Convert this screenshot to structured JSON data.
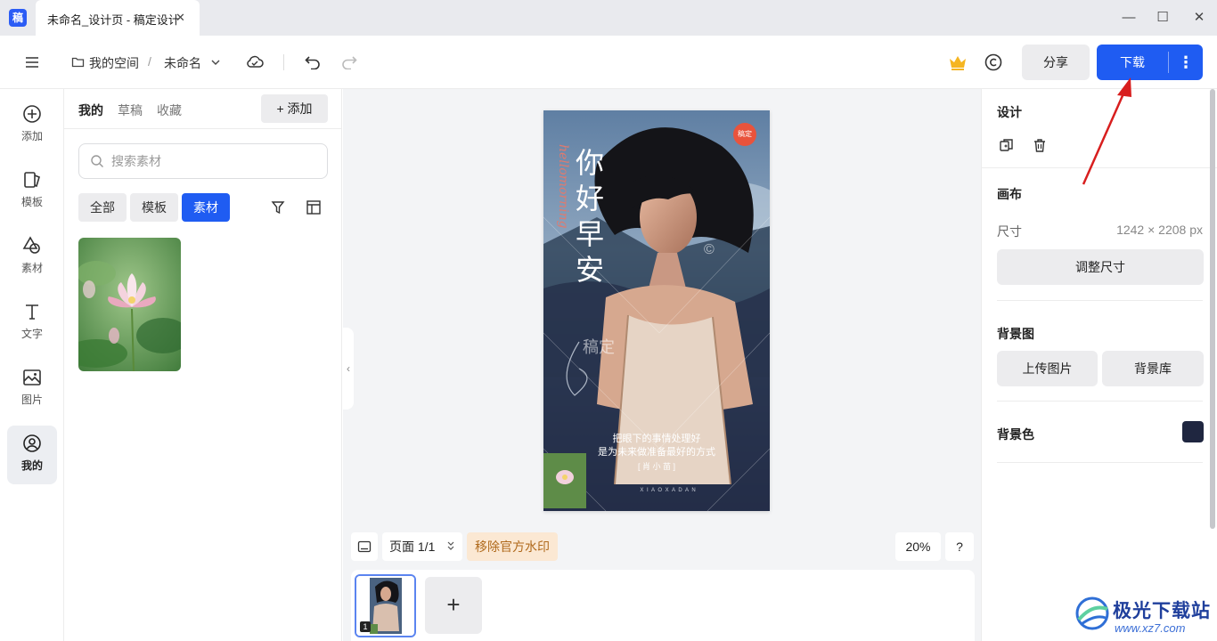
{
  "app": {
    "logo_char": "稿",
    "tab_title": "未命名_设计页 - 稿定设计",
    "tab_close": "✕",
    "window_controls": [
      "—",
      "☐",
      "✕"
    ]
  },
  "toolbar": {
    "breadcrumb_space": "我的空间",
    "breadcrumb_sep": "/",
    "breadcrumb_doc": "未命名",
    "share_label": "分享",
    "download_label": "下载",
    "download_more": "⋮"
  },
  "rail": {
    "items": [
      {
        "label": "添加",
        "icon": "plus-circle-icon"
      },
      {
        "label": "模板",
        "icon": "template-icon"
      },
      {
        "label": "素材",
        "icon": "shapes-icon"
      },
      {
        "label": "文字",
        "icon": "text-icon"
      },
      {
        "label": "图片",
        "icon": "image-icon"
      },
      {
        "label": "我的",
        "icon": "user-icon",
        "active": true
      }
    ]
  },
  "assets": {
    "tabs": [
      "我的",
      "草稿",
      "收藏"
    ],
    "active_tab": "我的",
    "add_label": "+ 添加",
    "search_placeholder": "搜索素材",
    "filters": [
      "全部",
      "模板",
      "素材"
    ],
    "active_filter": "素材"
  },
  "poster": {
    "badge": "稿定",
    "title_chars": [
      "你",
      "好",
      "早",
      "安"
    ],
    "vertical_text": "hellomorning",
    "watermark_a": "稿定",
    "watermark_b": "©",
    "line1": "把眼下的事情处理好",
    "line2": "是为未来做准备最好的方式",
    "author": "[ 肖 小 苗 ]",
    "footer": "X I A O   X A D A N"
  },
  "canvas": {
    "page_label": "页面 1/1",
    "watermark_btn": "移除官方水印",
    "zoom": "20%",
    "help": "?",
    "page_number": "1",
    "add_page": "+",
    "collapse": "‹"
  },
  "right_panel": {
    "design_title": "设计",
    "canvas_title": "画布",
    "size_label": "尺寸",
    "size_value": "1242 × 2208 px",
    "resize_label": "调整尺寸",
    "bg_image_title": "背景图",
    "upload_label": "上传图片",
    "library_label": "背景库",
    "bg_color_title": "背景色",
    "bg_color": "#1f2640"
  },
  "site_watermark": {
    "name": "极光下载站",
    "url": "www.xz7.com"
  },
  "colors": {
    "accent": "#1f5cf2",
    "annotation_arrow": "#d81e1e"
  }
}
